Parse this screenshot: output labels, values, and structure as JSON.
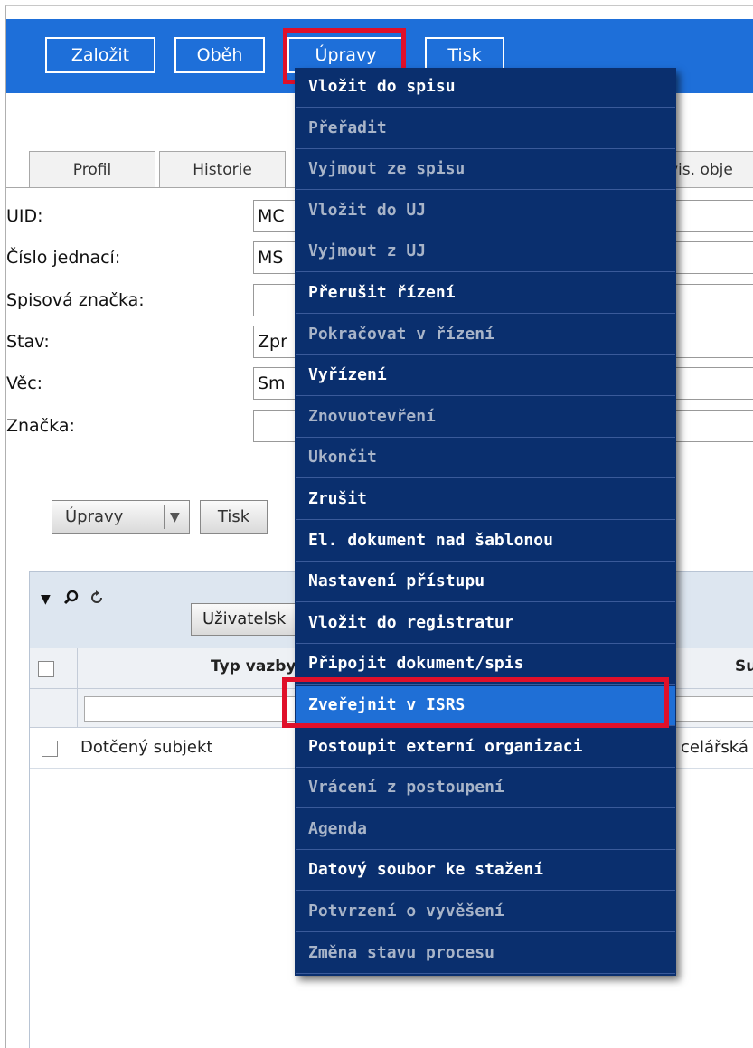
{
  "toolbar": {
    "buttons": [
      "Založit",
      "Oběh",
      "Úpravy",
      "Tisk"
    ]
  },
  "tabs": [
    "Profil",
    "Historie",
    "vis. obje"
  ],
  "form": {
    "fields": [
      {
        "label": "UID:",
        "value": "MC"
      },
      {
        "label": "Číslo jednací:",
        "value": "MS"
      },
      {
        "label": "Spisová značka:",
        "value": ""
      },
      {
        "label": "Stav:",
        "value": "Zpr"
      },
      {
        "label": "Věc:",
        "value": "Sm"
      },
      {
        "label": "Značka:",
        "value": ""
      }
    ]
  },
  "actions": {
    "upravy_label": "Úpravy",
    "tisk_label": "Tisk"
  },
  "grid": {
    "toolbar_button": "Uživatelsk",
    "col_typ": "Typ vazby",
    "col_su": "Su",
    "row_typ": "Dotčený subjekt",
    "row_su": "celářská"
  },
  "menu": {
    "items": [
      {
        "label": "Vložit do spisu",
        "enabled": true
      },
      {
        "label": "Přeřadit",
        "enabled": false
      },
      {
        "label": "Vyjmout ze spisu",
        "enabled": false
      },
      {
        "label": "Vložit do UJ",
        "enabled": false
      },
      {
        "label": "Vyjmout z UJ",
        "enabled": false
      },
      {
        "label": "Přerušit řízení",
        "enabled": true
      },
      {
        "label": "Pokračovat v řízení",
        "enabled": false
      },
      {
        "label": "Vyřízení",
        "enabled": true
      },
      {
        "label": "Znovuotevření",
        "enabled": false
      },
      {
        "label": "Ukončit",
        "enabled": false
      },
      {
        "label": "Zrušit",
        "enabled": true
      },
      {
        "label": "El. dokument nad šablonou",
        "enabled": true
      },
      {
        "label": "Nastavení přístupu",
        "enabled": true
      },
      {
        "label": "Vložit do registratur",
        "enabled": true
      },
      {
        "label": "Připojit dokument/spis",
        "enabled": true
      },
      {
        "label": "Zveřejnit v ISRS",
        "enabled": true,
        "selected": true
      },
      {
        "label": "Postoupit externí organizaci",
        "enabled": true
      },
      {
        "label": "Vrácení z postoupení",
        "enabled": false
      },
      {
        "label": "Agenda",
        "enabled": false
      },
      {
        "label": "Datový soubor ke stažení",
        "enabled": true
      },
      {
        "label": "Potvrzení o vyvěšení",
        "enabled": false
      },
      {
        "label": "Změna stavu procesu",
        "enabled": false
      }
    ]
  }
}
